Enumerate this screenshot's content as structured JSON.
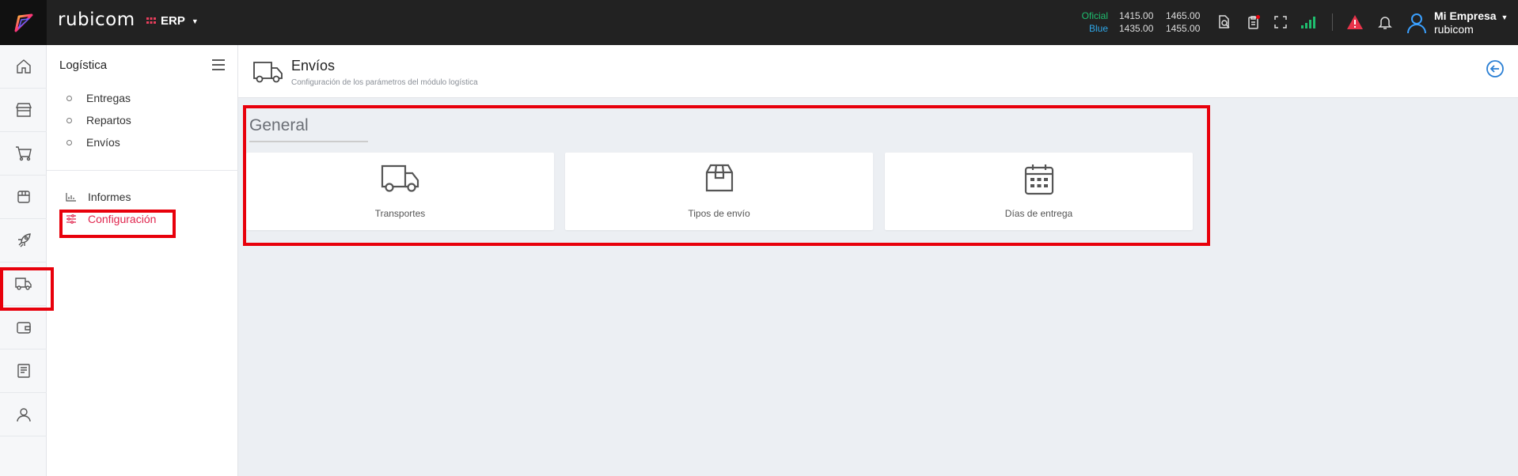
{
  "topbar": {
    "brand": "rubicom",
    "app_switch_label": "ERP",
    "rates": [
      {
        "label": "Oficial",
        "buy": "1415.00",
        "sell": "1465.00",
        "color": "#1fbf6f"
      },
      {
        "label": "Blue",
        "buy": "1435.00",
        "sell": "1455.00",
        "color": "#2fa7e8"
      }
    ],
    "user": {
      "company": "Mi Empresa",
      "account": "rubicom"
    },
    "icons": [
      "search-document-icon",
      "clipboard-icon",
      "fullscreen-icon",
      "signal-icon",
      "alert-icon",
      "bell-icon",
      "user-icon"
    ]
  },
  "rail": {
    "items": [
      "home-icon",
      "store-icon",
      "cart-icon",
      "box-icon",
      "rocket-icon",
      "truck-icon",
      "wallet-icon",
      "book-icon",
      "person-icon"
    ],
    "active": "truck-icon"
  },
  "sidebar": {
    "title": "Logística",
    "items": [
      {
        "label": "Entregas"
      },
      {
        "label": "Repartos"
      },
      {
        "label": "Envíos"
      }
    ],
    "secondary": [
      {
        "label": "Informes",
        "icon": "chart-icon"
      },
      {
        "label": "Configuración",
        "icon": "sliders-icon",
        "active": true
      }
    ]
  },
  "page": {
    "title": "Envíos",
    "subtitle": "Configuración de los parámetros del módulo logística"
  },
  "section": {
    "title": "General",
    "cards": [
      {
        "label": "Transportes",
        "icon": "truck-icon"
      },
      {
        "label": "Tipos de envío",
        "icon": "package-icon"
      },
      {
        "label": "Días de entrega",
        "icon": "calendar-icon"
      }
    ]
  },
  "colors": {
    "topbar_bg": "#222222",
    "accent_red": "#e8000b",
    "active_link": "#e0264e",
    "brand_pink": "#e83e5c",
    "link_blue": "#2a7fd4"
  }
}
